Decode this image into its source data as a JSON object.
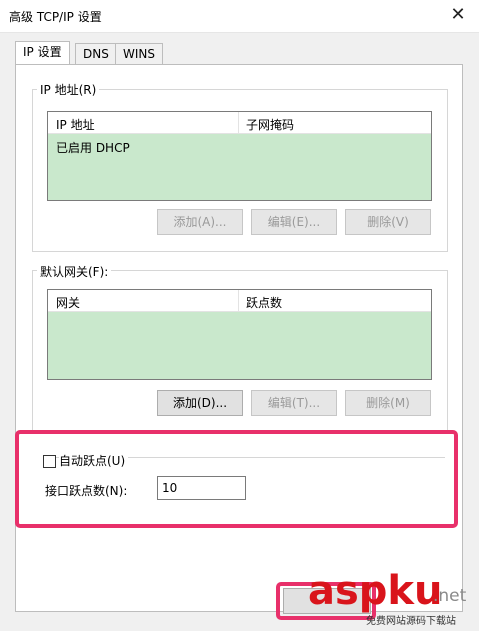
{
  "window": {
    "title": "高级 TCP/IP 设置",
    "close_glyph": "✕"
  },
  "tabs": [
    {
      "label": "IP 设置",
      "active": true
    },
    {
      "label": "DNS",
      "active": false
    },
    {
      "label": "WINS",
      "active": false
    }
  ],
  "ip_section": {
    "legend": "IP 地址(R)",
    "columns": [
      "IP 地址",
      "子网掩码"
    ],
    "rows": [
      [
        "已启用 DHCP",
        ""
      ]
    ],
    "buttons": {
      "add": "添加(A)...",
      "edit": "编辑(E)...",
      "delete": "删除(V)"
    }
  },
  "gateway_section": {
    "legend": "默认网关(F):",
    "columns": [
      "网关",
      "跃点数"
    ],
    "rows": [],
    "buttons": {
      "add": "添加(D)...",
      "edit": "编辑(T)...",
      "delete": "删除(M)"
    }
  },
  "metric": {
    "auto_metric_label": "自动跃点(U)",
    "auto_metric_checked": false,
    "interface_metric_label": "接口跃点数(N):",
    "interface_metric_value": "10"
  },
  "watermark": {
    "brand": "aspku",
    "suffix": ".net",
    "sub": "免费网站源码下载站"
  },
  "colors": {
    "highlight": "#e8306a",
    "list_bg": "#c9e8cc",
    "brand_red": "#d9141b"
  }
}
